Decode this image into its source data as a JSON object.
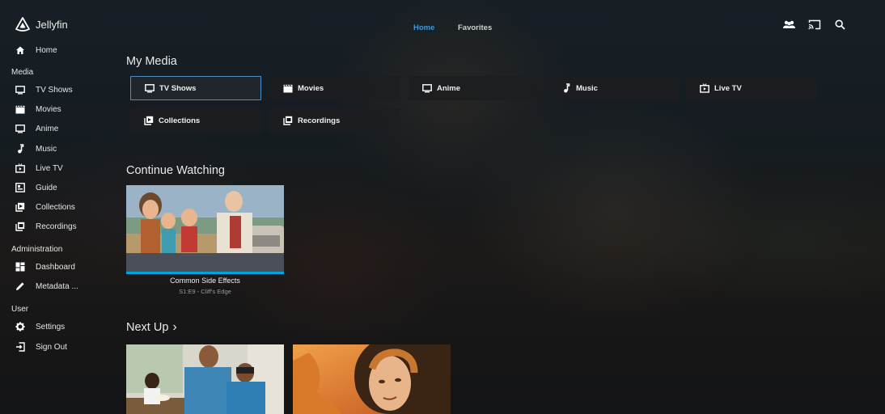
{
  "app": {
    "name": "Jellyfin"
  },
  "top_nav": {
    "tabs": [
      {
        "label": "Home",
        "active": true
      },
      {
        "label": "Favorites",
        "active": false
      }
    ],
    "icons": [
      "users-icon",
      "cast-icon",
      "search-icon"
    ]
  },
  "sidebar": {
    "home": {
      "label": "Home",
      "icon": "home-icon"
    },
    "media_section": "Media",
    "media_items": [
      {
        "label": "TV Shows",
        "icon": "tv-icon"
      },
      {
        "label": "Movies",
        "icon": "film-icon"
      },
      {
        "label": "Anime",
        "icon": "tv-icon"
      },
      {
        "label": "Music",
        "icon": "music-note-icon"
      },
      {
        "label": "Live TV",
        "icon": "live-tv-icon"
      },
      {
        "label": "Guide",
        "icon": "guide-icon"
      },
      {
        "label": "Collections",
        "icon": "collections-icon"
      },
      {
        "label": "Recordings",
        "icon": "recordings-icon"
      }
    ],
    "admin_section": "Administration",
    "admin_items": [
      {
        "label": "Dashboard",
        "icon": "dashboard-icon"
      },
      {
        "label": "Metadata ...",
        "icon": "edit-icon"
      }
    ],
    "user_section": "User",
    "user_items": [
      {
        "label": "Settings",
        "icon": "gear-icon"
      },
      {
        "label": "Sign Out",
        "icon": "sign-out-icon"
      }
    ]
  },
  "my_media": {
    "title": "My Media",
    "buttons": [
      {
        "label": "TV Shows",
        "icon": "tv-icon",
        "selected": true
      },
      {
        "label": "Movies",
        "icon": "film-icon",
        "selected": false
      },
      {
        "label": "Anime",
        "icon": "tv-icon",
        "selected": false
      },
      {
        "label": "Music",
        "icon": "music-note-icon",
        "selected": false
      },
      {
        "label": "Live TV",
        "icon": "live-tv-icon",
        "selected": false
      },
      {
        "label": "Collections",
        "icon": "collections-icon",
        "selected": false
      },
      {
        "label": "Recordings",
        "icon": "recordings-icon",
        "selected": false
      }
    ]
  },
  "continue_watching": {
    "title": "Continue Watching",
    "items": [
      {
        "title": "Common Side Effects",
        "subtitle": "S1:E9 - Cliff's Edge",
        "progress": 1.0
      }
    ]
  },
  "next_up": {
    "title": "Next Up",
    "chevron": "›"
  },
  "colors": {
    "accent": "#00a4dc",
    "active_tab": "#3a9bdc"
  }
}
